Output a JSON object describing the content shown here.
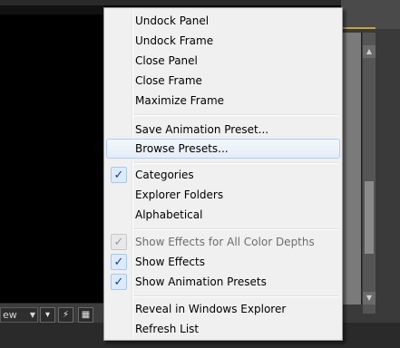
{
  "menu": {
    "items": [
      {
        "label": "Undock Panel"
      },
      {
        "label": "Undock Frame"
      },
      {
        "label": "Close Panel"
      },
      {
        "label": "Close Frame"
      },
      {
        "label": "Maximize Frame"
      },
      {
        "label": "Save Animation Preset..."
      },
      {
        "label": "Browse Presets..."
      },
      {
        "label": "Categories",
        "checked": true
      },
      {
        "label": "Explorer Folders"
      },
      {
        "label": "Alphabetical"
      },
      {
        "label": "Show Effects for All Color Depths",
        "checked": true,
        "disabled": true
      },
      {
        "label": "Show Effects",
        "checked": true
      },
      {
        "label": "Show Animation Presets",
        "checked": true
      },
      {
        "label": "Reveal in Windows Explorer"
      },
      {
        "label": "Refresh List"
      }
    ]
  },
  "toolbar": {
    "view_label": "ew"
  },
  "colors": {
    "accent": "#c8a23a",
    "menu_bg": "#f0f0f0",
    "highlight_border": "#aecff7",
    "check_mark": "#1a3f95"
  }
}
